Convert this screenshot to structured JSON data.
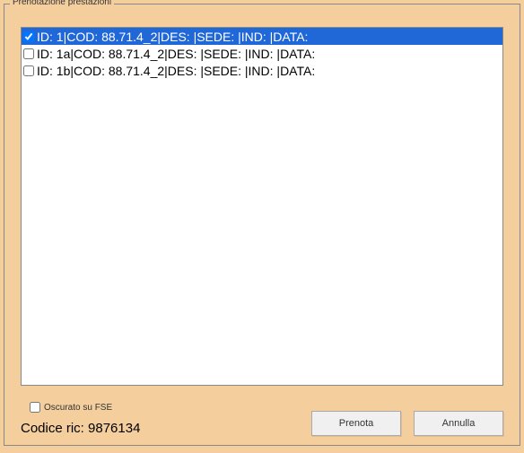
{
  "groupbox": {
    "title": "Prenotazione prestazioni"
  },
  "list": {
    "items": [
      {
        "checked": true,
        "selected": true,
        "text": "ID: 1|COD: 88.71.4_2|DES: |SEDE: |IND: |DATA:"
      },
      {
        "checked": false,
        "selected": false,
        "text": "ID: 1a|COD: 88.71.4_2|DES: |SEDE: |IND: |DATA:"
      },
      {
        "checked": false,
        "selected": false,
        "text": "ID: 1b|COD: 88.71.4_2|DES: |SEDE: |IND: |DATA:"
      }
    ]
  },
  "oscurato": {
    "label": "Oscurato su FSE",
    "checked": false
  },
  "codice": {
    "prefix": "Codice ric: ",
    "value": "9876134"
  },
  "buttons": {
    "prenota": "Prenota",
    "annulla": "Annulla"
  }
}
